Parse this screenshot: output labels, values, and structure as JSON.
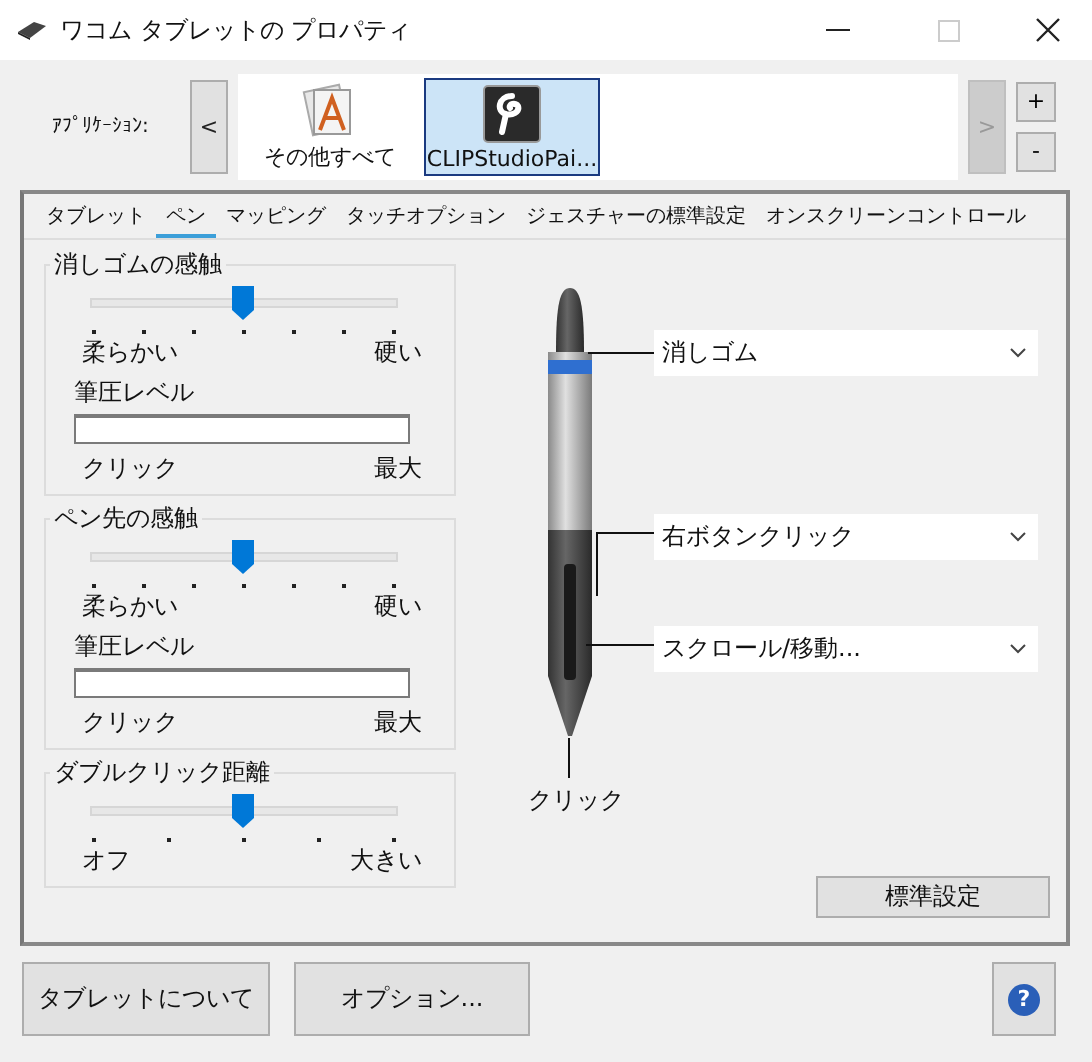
{
  "window": {
    "title": "ワコム タブレットの プロパティ"
  },
  "applications": {
    "label": "ｱﾌﾟﾘｹｰｼｮﾝ:",
    "prev": "<",
    "next": ">",
    "next_disabled": true,
    "add": "+",
    "remove": "-",
    "items": [
      {
        "label": "その他すべて",
        "selected": false
      },
      {
        "label": "CLIPStudioPai...",
        "selected": true
      }
    ]
  },
  "tabs": [
    {
      "label": "タブレット",
      "selected": false
    },
    {
      "label": "ペン",
      "selected": true
    },
    {
      "label": "マッピング",
      "selected": false
    },
    {
      "label": "タッチオプション",
      "selected": false
    },
    {
      "label": "ジェスチャーの標準設定",
      "selected": false
    },
    {
      "label": "オンスクリーンコントロール",
      "selected": false
    }
  ],
  "groups": [
    {
      "kind": "feel",
      "title": "消しゴムの感触",
      "level": 0.5,
      "min_label": "柔らかい",
      "max_label": "硬い",
      "pressure": {
        "label": "筆圧レベル",
        "level": 0,
        "min_label": "クリック",
        "max_label": "最大"
      }
    },
    {
      "kind": "feel",
      "title": "ペン先の感触",
      "level": 0.5,
      "min_label": "柔らかい",
      "max_label": "硬い",
      "pressure": {
        "label": "筆圧レベル",
        "level": 0,
        "min_label": "クリック",
        "max_label": "最大"
      }
    },
    {
      "kind": "distance",
      "title": "ダブルクリック距離",
      "level": 0.5,
      "min_label": "オフ",
      "max_label": "大きい"
    }
  ],
  "pen": {
    "buttons": [
      {
        "value": "消しゴム"
      },
      {
        "value": "右ボタンクリック"
      },
      {
        "value": "スクロール/移動..."
      }
    ],
    "tip_label": "クリック",
    "default_button": "標準設定"
  },
  "footer": {
    "buttons": [
      "タブレットについて",
      "オプション..."
    ],
    "help": "?"
  }
}
